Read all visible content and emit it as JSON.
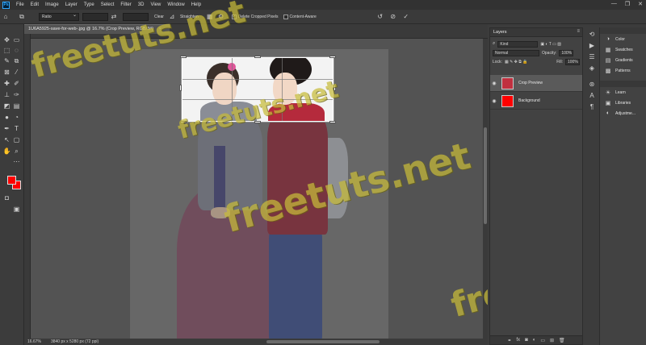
{
  "app": {
    "logo": "Ps",
    "menu": [
      "File",
      "Edit",
      "Image",
      "Layer",
      "Type",
      "Select",
      "Filter",
      "3D",
      "View",
      "Window",
      "Help"
    ],
    "window_controls": [
      "—",
      "❐",
      "✕"
    ]
  },
  "options_bar": {
    "ratio_value": "Ratio",
    "clear_label": "Clear",
    "straighten_label": "Straighten",
    "delete_cropped_label": "Delete Cropped Pixels",
    "delete_cropped_checked": true,
    "content_aware_label": "Content-Aware",
    "content_aware_checked": false
  },
  "document": {
    "tab_title": "1U6A5925-save-for-web-.jpg @ 16.7% (Crop Preview, RGB/8#)",
    "zoom": "16.67%",
    "dimensions": "3840 px x 5280 px (72 ppi)"
  },
  "layers_panel": {
    "title": "Layers",
    "kind_placeholder": "Kind",
    "blend_mode": "Normal",
    "opacity_label": "Opacity:",
    "opacity_value": "100%",
    "lock_label": "Lock:",
    "fill_label": "Fill:",
    "fill_value": "100%",
    "layers": [
      {
        "name": "Crop Preview",
        "active": true,
        "thumb_color": "#c0303f"
      },
      {
        "name": "Background",
        "active": false,
        "thumb_color": "#ff0000"
      }
    ]
  },
  "right_panels": {
    "group1": [
      "Color",
      "Swatches",
      "Gradients",
      "Patterns"
    ],
    "group2": [
      "Learn",
      "Libraries",
      "Adjustme..."
    ]
  },
  "colors": {
    "foreground": "#ff0000",
    "background": "#ff0000",
    "watermark": "#c8bc3a"
  },
  "watermarks": [
    "freetuts.net",
    "freetuts.net",
    "freetuts.net",
    "freetuts.net",
    "freetuts.net"
  ]
}
